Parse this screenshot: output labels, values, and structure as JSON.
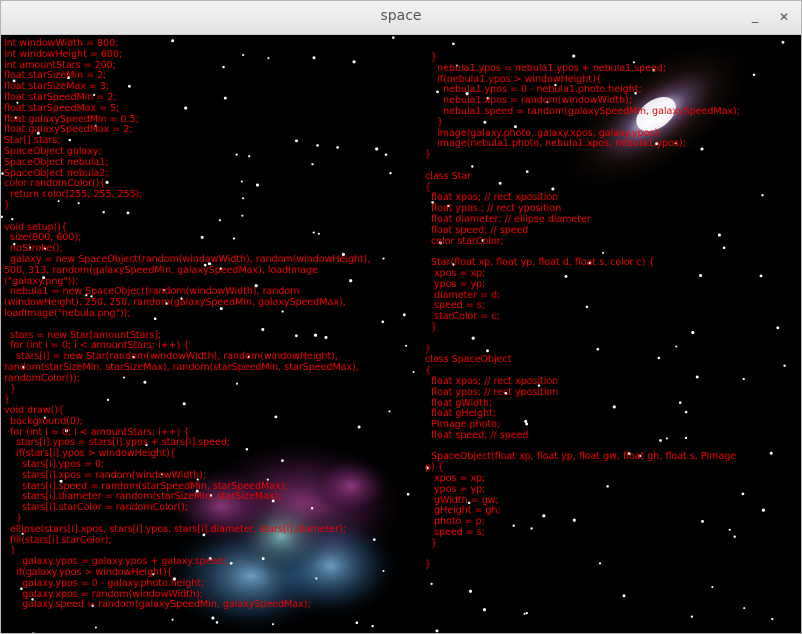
{
  "window": {
    "title": "space",
    "minimize_glyph": "_",
    "close_glyph": "✕"
  },
  "code_left": [
    "int windowWidth = 800;",
    "int windowHeight = 600;",
    "int amountStars = 200;",
    "float starSizeMin = 2;",
    "float starSizeMax = 3;",
    "float starSpeedMin = 2;",
    "float starSpeedMax = 5;",
    "float galaxySpeedMin = 0.5;",
    "float galaxySpeedMax = 2;",
    "Star[] stars;",
    "SpaceObject galaxy;",
    "SpaceObject nebula1;",
    "SpaceObject nebula2;",
    "color randomColor(){",
    "  return color(255, 255, 255);",
    "}",
    "",
    "void setup(){",
    "  size(800, 600);",
    "  noStroke();",
    "  galaxy = new SpaceObject(random(windowWidth), random(windowHeight),",
    "500, 313, random(galaxySpeedMin, galaxySpeedMax), loadImage",
    "(\"galaxy.png\"));",
    "  nebula1 = new SpaceObject(random(windowWidth), random",
    "(windowHeight), 250, 250, random(galaxySpeedMin, galaxySpeedMax),",
    "loadImage(\"nebula.png\"));",
    "",
    "  stars = new Star[amountStars];",
    "  for (int i = 0; i < amountStars; i++) {",
    "    stars[i] = new Star(random(windowWidth), random(windowHeight),",
    "random(starSizeMin, starSizeMax), random(starSpeedMin, starSpeedMax),",
    "randomColor());",
    "  }",
    "}",
    "void draw(){",
    "  background(0);",
    "  for (int i = 0; i < amountStars; i++) {",
    "    stars[i].ypos = stars[i].ypos + stars[i].speed;",
    "    if(stars[i].ypos > windowHeight){",
    "      stars[i].ypos = 0;",
    "      stars[i].xpos = random(windowWidth);",
    "      stars[i].speed = random(starSpeedMin, starSpeedMax);",
    "      stars[i].diameter = random(starSizeMin, starSizeMax);",
    "      stars[i].starColor = randomColor();",
    "    }",
    "  ellipse(stars[i].xpos, stars[i].ypos, stars[i].diameter, stars[i].diameter);",
    "  fill(stars[i].starColor);",
    "  }",
    "      galaxy.ypos = galaxy.ypos + galaxy.speed;",
    "    if(galaxy.ypos > windowHeight){",
    "      galaxy.ypos = 0 - galaxy.photo.height;",
    "      galaxy.xpos = random(windowWidth);",
    "      galaxy.speed = random(galaxySpeedMin, galaxySpeedMax);"
  ],
  "code_right": [
    "  }",
    "    nebula1.ypos = nebula1.ypos + nebula1.speed;",
    "    if(nebula1.ypos > windowHeight){",
    "      nebula1.ypos = 0 - nebula1.photo.height;",
    "      nebula1.xpos = random(windowWidth);",
    "      nebula1.speed = random(galaxySpeedMin, galaxySpeedMax);",
    "    }",
    "    image(galaxy.photo, galaxy.xpos, galaxy.ypos);",
    "    image(nebula1.photo, nebula1.xpos, nebula1.ypos);",
    "}",
    "",
    "class Star",
    "{",
    "  float xpos; // rect xposition",
    "  float ypos ; // rect yposition",
    "  float diameter; // ellipse diameter",
    "  float speed; // speed",
    "  color starColor;",
    "",
    "  Star(float xp, float yp, float d, float s, color c) {",
    "   xpos = xp;",
    "   ypos = yp;",
    "   diameter = d;",
    "   speed = s;",
    "   starColor = c;",
    "  }",
    "",
    "}",
    "class SpaceObject",
    "{",
    "  float xpos; // rect xposition",
    "  float ypos; // rect yposition",
    "  float gWidth;",
    "  float gHeight;",
    "  PImage photo;",
    "  float speed; // speed",
    "",
    "  SpaceObject(float xp, float yp, float gw, float gh, float s, PImage",
    "p) {",
    "   xpos = xp;",
    "   ypos = yp;",
    "   gWidth = gw;",
    "   gHeight = gh;",
    "   photo = p;",
    "   speed = s;",
    "  }",
    "",
    "}"
  ],
  "colors": {
    "code_text": "#f00000",
    "canvas_bg": "#000000",
    "star": "#ffffff"
  }
}
